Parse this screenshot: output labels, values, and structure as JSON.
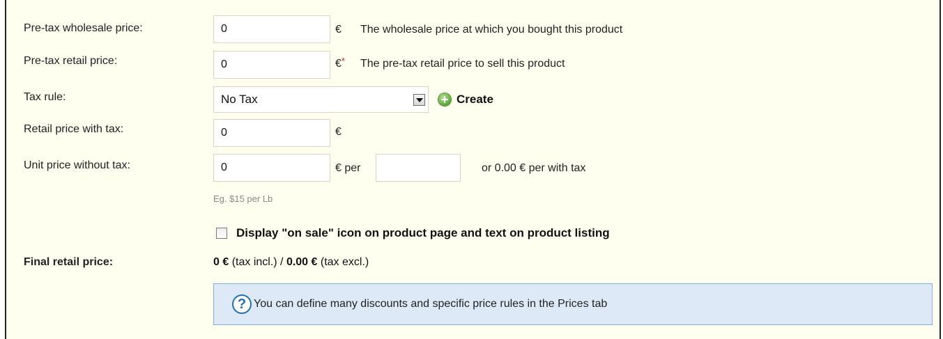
{
  "rows": {
    "wholesale": {
      "label": "Pre-tax wholesale price:",
      "value": "0",
      "currency": "€",
      "description": "The wholesale price at which you bought this product"
    },
    "retail": {
      "label": "Pre-tax retail price:",
      "value": "0",
      "currency": "€",
      "required_mark": "*",
      "description": "The pre-tax retail price to sell this product"
    },
    "tax_rule": {
      "label": "Tax rule:",
      "selected": "No Tax",
      "create_label": "Create"
    },
    "retail_with_tax": {
      "label": "Retail price with tax:",
      "value": "0",
      "currency": "€"
    },
    "unit_price": {
      "label": "Unit price without tax:",
      "value": "0",
      "currency_per": "€ per",
      "unit_value": "",
      "with_tax_text": "or 0.00 € per with tax",
      "hint": "Eg. $15 per Lb"
    }
  },
  "on_sale": {
    "checked": false,
    "label": "Display \"on sale\" icon on product page and text on product listing"
  },
  "final_price": {
    "label": "Final retail price:",
    "incl_value": "0 €",
    "incl_suffix": " (tax incl.) / ",
    "excl_value": "0.00 €",
    "excl_suffix": " (tax excl.)"
  },
  "info_box": {
    "text": "You can define many discounts and specific price rules in the Prices tab"
  },
  "icons": {
    "create": "plus-circle-icon",
    "info": "question-mark-icon",
    "select": "chevron-down-icon"
  }
}
